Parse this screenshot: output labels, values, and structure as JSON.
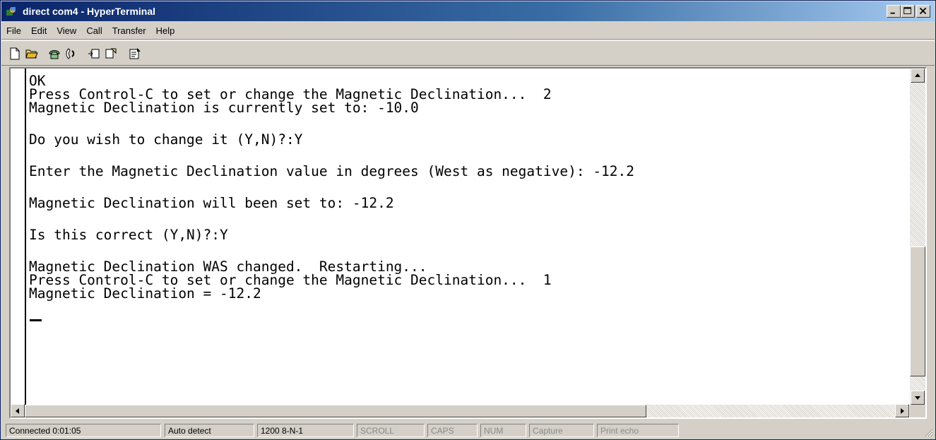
{
  "window": {
    "title": "direct com4 - HyperTerminal"
  },
  "menu": [
    "File",
    "Edit",
    "View",
    "Call",
    "Transfer",
    "Help"
  ],
  "toolbar": {
    "buttons": [
      "new-icon",
      "open-icon",
      "connect-icon",
      "disconnect-icon",
      "send-icon",
      "receive-icon",
      "properties-icon"
    ]
  },
  "terminal": {
    "lines": [
      "OK",
      "Press Control-C to set or change the Magnetic Declination...  2",
      "Magnetic Declination is currently set to: -10.0",
      "Do you wish to change it (Y,N)?:Y",
      "Enter the Magnetic Declination value in degrees (West as negative): -12.2",
      "Magnetic Declination will been set to: -12.2",
      "Is this correct (Y,N)?:Y",
      "Magnetic Declination WAS changed.  Restarting...",
      "Press Control-C to set or change the Magnetic Declination...  1",
      "Magnetic Declination = -12.2"
    ]
  },
  "status": {
    "connected": "Connected 0:01:05",
    "detect": "Auto detect",
    "settings": "1200 8-N-1",
    "scroll": "SCROLL",
    "caps": "CAPS",
    "num": "NUM",
    "capture": "Capture",
    "print_echo": "Print echo"
  },
  "colors": {
    "titlebar_start": "#0a246a",
    "titlebar_end": "#a6caf0",
    "chrome": "#d4d0c8"
  }
}
